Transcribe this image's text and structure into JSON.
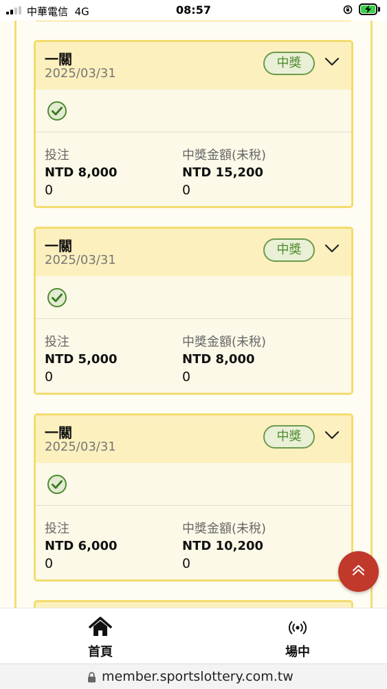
{
  "status_bar": {
    "carrier": "中華電信",
    "network": "4G",
    "time": "08:57"
  },
  "cards": [
    {
      "title": "一關",
      "date": "2025/03/31",
      "badge": "中獎",
      "stake_label": "投注",
      "stake_amount": "NTD 8,000",
      "stake_extra": "0",
      "payout_label": "中獎金額(未稅)",
      "payout_amount": "NTD 15,200",
      "payout_extra": "0"
    },
    {
      "title": "一關",
      "date": "2025/03/31",
      "badge": "中獎",
      "stake_label": "投注",
      "stake_amount": "NTD 5,000",
      "stake_extra": "0",
      "payout_label": "中獎金額(未稅)",
      "payout_amount": "NTD 8,000",
      "payout_extra": "0"
    },
    {
      "title": "一關",
      "date": "2025/03/31",
      "badge": "中獎",
      "stake_label": "投注",
      "stake_amount": "NTD 6,000",
      "stake_extra": "0",
      "payout_label": "中獎金額(未稅)",
      "payout_amount": "NTD 10,200",
      "payout_extra": "0"
    }
  ],
  "bottom_nav": {
    "home_label": "首頁",
    "live_label": "場中"
  },
  "browser": {
    "url": "member.sportslottery.com.tw"
  },
  "colors": {
    "card_border": "#f3dc6e",
    "card_header": "#fcf0be",
    "badge_green": "#4e8a2e",
    "fab_red": "#c0392b"
  }
}
